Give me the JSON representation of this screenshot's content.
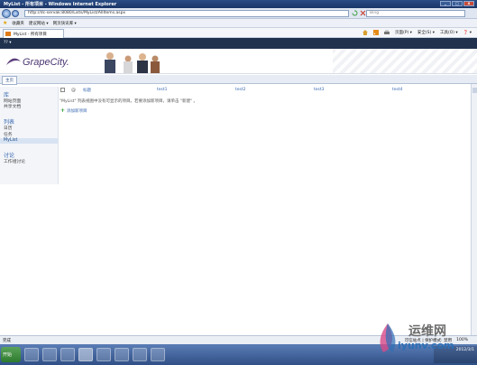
{
  "window": {
    "title": "MyList - 所有项目 - Windows Internet Explorer",
    "address": "http://dc-servak:8080/Lists/MyList/AllItems.aspx",
    "search_placeholder": "Bing"
  },
  "favorites_bar": {
    "label": "收藏夹",
    "items": [
      "建议网站 ▾",
      "网页快讯库 ▾"
    ]
  },
  "tab": {
    "label": "MyList - 所有项目"
  },
  "commands": [
    "页面(P) ▾",
    "安全(S) ▾",
    "工具(O) ▾",
    "❓ ▾"
  ],
  "sp": {
    "top_link": "?? ▾",
    "logo_text": "GrapeCity.",
    "home_tab": "主页"
  },
  "quicklaunch": {
    "sections": [
      {
        "heading": "库",
        "items": [
          "网站页面",
          "共享文档"
        ]
      },
      {
        "heading": "列表",
        "items": [
          "日历",
          "任务",
          "MyList"
        ]
      },
      {
        "heading": "讨论",
        "items": [
          "工作组讨论"
        ]
      }
    ],
    "selected": "MyList"
  },
  "list": {
    "columns": [
      "标题",
      "test1",
      "test2",
      "test3",
      "test4"
    ],
    "empty_message": "\"MyList\" 列表视图中没有可显示的项目。若要添加新项目，请单击 \"新建\" 。",
    "add_new": "添加新项目"
  },
  "statusbar": {
    "left": "完成",
    "zone": "可信站点 | 保护模式: 禁用",
    "zoom": "100%"
  },
  "taskbar": {
    "start": "开始",
    "clock_date": "2012/3/1"
  },
  "watermark": {
    "line1": "运维网",
    "line2": "iyunv.com"
  }
}
